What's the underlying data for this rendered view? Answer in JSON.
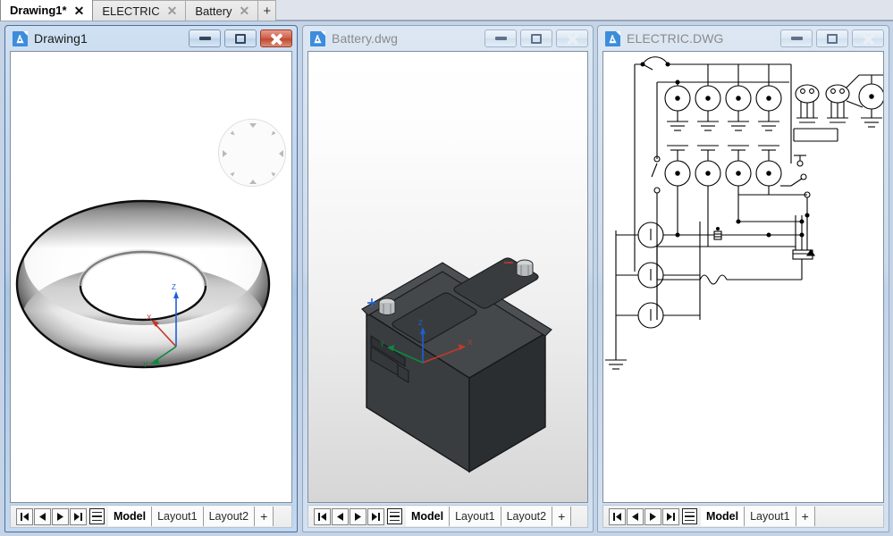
{
  "app": {
    "accent_blue": "#3c8ddc",
    "mdi_background": "#c5d3e6",
    "close_button_red": "#c0472f"
  },
  "tabbar": {
    "tabs": [
      {
        "label": "Drawing1*",
        "close": "✕",
        "active": true
      },
      {
        "label": "ELECTRIC",
        "close": "✕",
        "active": false
      },
      {
        "label": "Battery",
        "close": "✕",
        "active": false
      }
    ],
    "new_tab_label": "+"
  },
  "windows": [
    {
      "title": "Drawing1",
      "active": true,
      "icon": "autocad-document-icon",
      "minimize_label": "–",
      "maximize_label": "□",
      "close_label": "✕",
      "canvas_style": "white",
      "drawing": "torus-3d-shaded",
      "ucs": {
        "x_label": "X",
        "y_label": "Y",
        "z_label": "Z",
        "x_color": "#c0392b",
        "y_color": "#0a8a3c",
        "z_color": "#1d5fd6"
      },
      "navwheel": "view-navigation-wheel",
      "status": {
        "first_label": "⏮",
        "prev_label": "◀",
        "next_label": "▶",
        "last_label": "⏭",
        "layout_list_label": "layout-list",
        "layouts": [
          {
            "label": "Model",
            "active": true
          },
          {
            "label": "Layout1",
            "active": false
          },
          {
            "label": "Layout2",
            "active": false
          }
        ],
        "add_layout_label": "+"
      }
    },
    {
      "title": "Battery.dwg",
      "active": false,
      "icon": "autocad-document-icon",
      "minimize_label": "–",
      "maximize_label": "□",
      "close_label": "✕",
      "canvas_style": "gradient",
      "drawing": "battery-3d-isometric",
      "ucs": {
        "x_label": "X",
        "y_label": "Y",
        "z_label": "Z",
        "x_color": "#c0392b",
        "y_color": "#0a8a3c",
        "z_color": "#1d5fd6"
      },
      "status": {
        "first_label": "⏮",
        "prev_label": "◀",
        "next_label": "▶",
        "last_label": "⏭",
        "layout_list_label": "layout-list",
        "layouts": [
          {
            "label": "Model",
            "active": true
          },
          {
            "label": "Layout1",
            "active": false
          },
          {
            "label": "Layout2",
            "active": false
          }
        ],
        "add_layout_label": "+"
      }
    },
    {
      "title": "ELECTRIC.DWG",
      "active": false,
      "icon": "autocad-document-icon",
      "minimize_label": "–",
      "maximize_label": "□",
      "close_label": "✕",
      "canvas_style": "white",
      "drawing": "electrical-schematic-2d",
      "status": {
        "first_label": "⏮",
        "prev_label": "◀",
        "next_label": "▶",
        "last_label": "⏭",
        "layout_list_label": "layout-list",
        "layouts": [
          {
            "label": "Model",
            "active": true
          },
          {
            "label": "Layout1",
            "active": false
          }
        ],
        "add_layout_label": "+"
      }
    }
  ]
}
